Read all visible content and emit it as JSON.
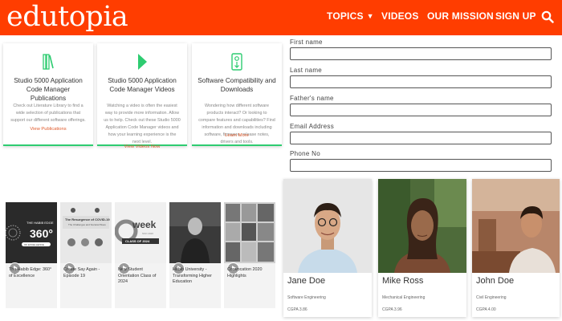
{
  "header": {
    "logo": "edutopia",
    "nav": [
      "TOPICS",
      "VIDEOS",
      "OUR MISSION",
      "SIGN UP"
    ],
    "brand_color": "#ff3d00"
  },
  "products": [
    {
      "title": "Studio 5000 Application Code Manager Publications",
      "description": "Check out Literature Library to find a wide selection of publications that support our different software offerings.",
      "link": "View Publications",
      "icon": "books-icon"
    },
    {
      "title": "Studio 5000 Application Code Manager Videos",
      "description": "Watching a video is often the easiest way to provide more information. Allow us to help. Check out these Studio 5000 Application Code Manager videos and how your learning experience is the next level.",
      "link": "View Videos Now",
      "icon": "play-icon"
    },
    {
      "title": "Software Compatibility and Downloads",
      "description": "Wondering how different software products interact? Or looking to compare features and capabilities? Find information and downloads including software, firmware, release notes, drivers and tools.",
      "link": "Learn More",
      "icon": "download-icon"
    }
  ],
  "form": {
    "fields": [
      {
        "label": "First name",
        "value": ""
      },
      {
        "label": "Last name",
        "value": ""
      },
      {
        "label": "Father's name",
        "value": ""
      },
      {
        "label": "Email Address",
        "value": ""
      },
      {
        "label": "Phone No",
        "value": ""
      }
    ]
  },
  "videos": [
    {
      "title": "The Habib Edge: 360° of Excellence",
      "thumb_text": "THE HABIB EDGE 360° OF EXCELLENCE"
    },
    {
      "title": "Create Say Again - Episode 19",
      "thumb_text": "The Resurgence of COVID-19 The Challenges and Societal Woes"
    },
    {
      "title": "New Student Orientation Class of 2024",
      "thumb_text": "week CLASS OF 2024"
    },
    {
      "title": "Habib University - Transforming Higher Education",
      "thumb_text": ""
    },
    {
      "title": "Convocation 2020 Highlights",
      "thumb_text": ""
    }
  ],
  "people": [
    {
      "name": "Jane Doe",
      "department": "Software Engineering",
      "cgpa": "CGPA 3.86"
    },
    {
      "name": "Mike Ross",
      "department": "Mechanical Engineering",
      "cgpa": "CGPA 3.96"
    },
    {
      "name": "John Doe",
      "department": "Civil Engineering",
      "cgpa": "CGPA 4.00"
    }
  ]
}
